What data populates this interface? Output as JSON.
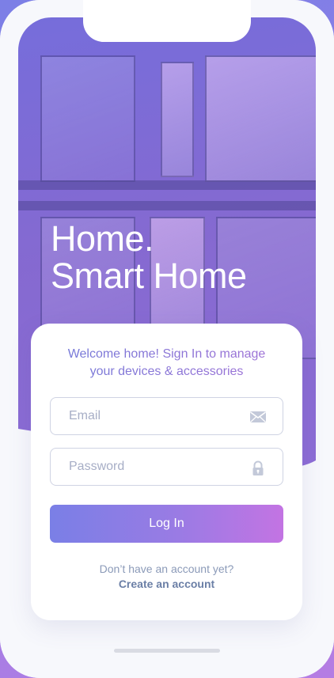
{
  "hero": {
    "line1": "Home.",
    "line2": "Smart Home"
  },
  "card": {
    "welcome_line1": "Welcome home! Sign In to manage",
    "welcome_line2": "your devices & accessories"
  },
  "email": {
    "placeholder": "Email",
    "value": "",
    "icon": "mail-icon"
  },
  "password": {
    "placeholder": "Password",
    "value": "",
    "icon": "lock-icon"
  },
  "login": {
    "label": "Log In"
  },
  "signup": {
    "prompt": "Don’t have an account yet?",
    "link": "Create an account"
  },
  "colors": {
    "accent_start": "#7a7fe6",
    "accent_end": "#c374e3",
    "link": "#6b7fa6"
  }
}
